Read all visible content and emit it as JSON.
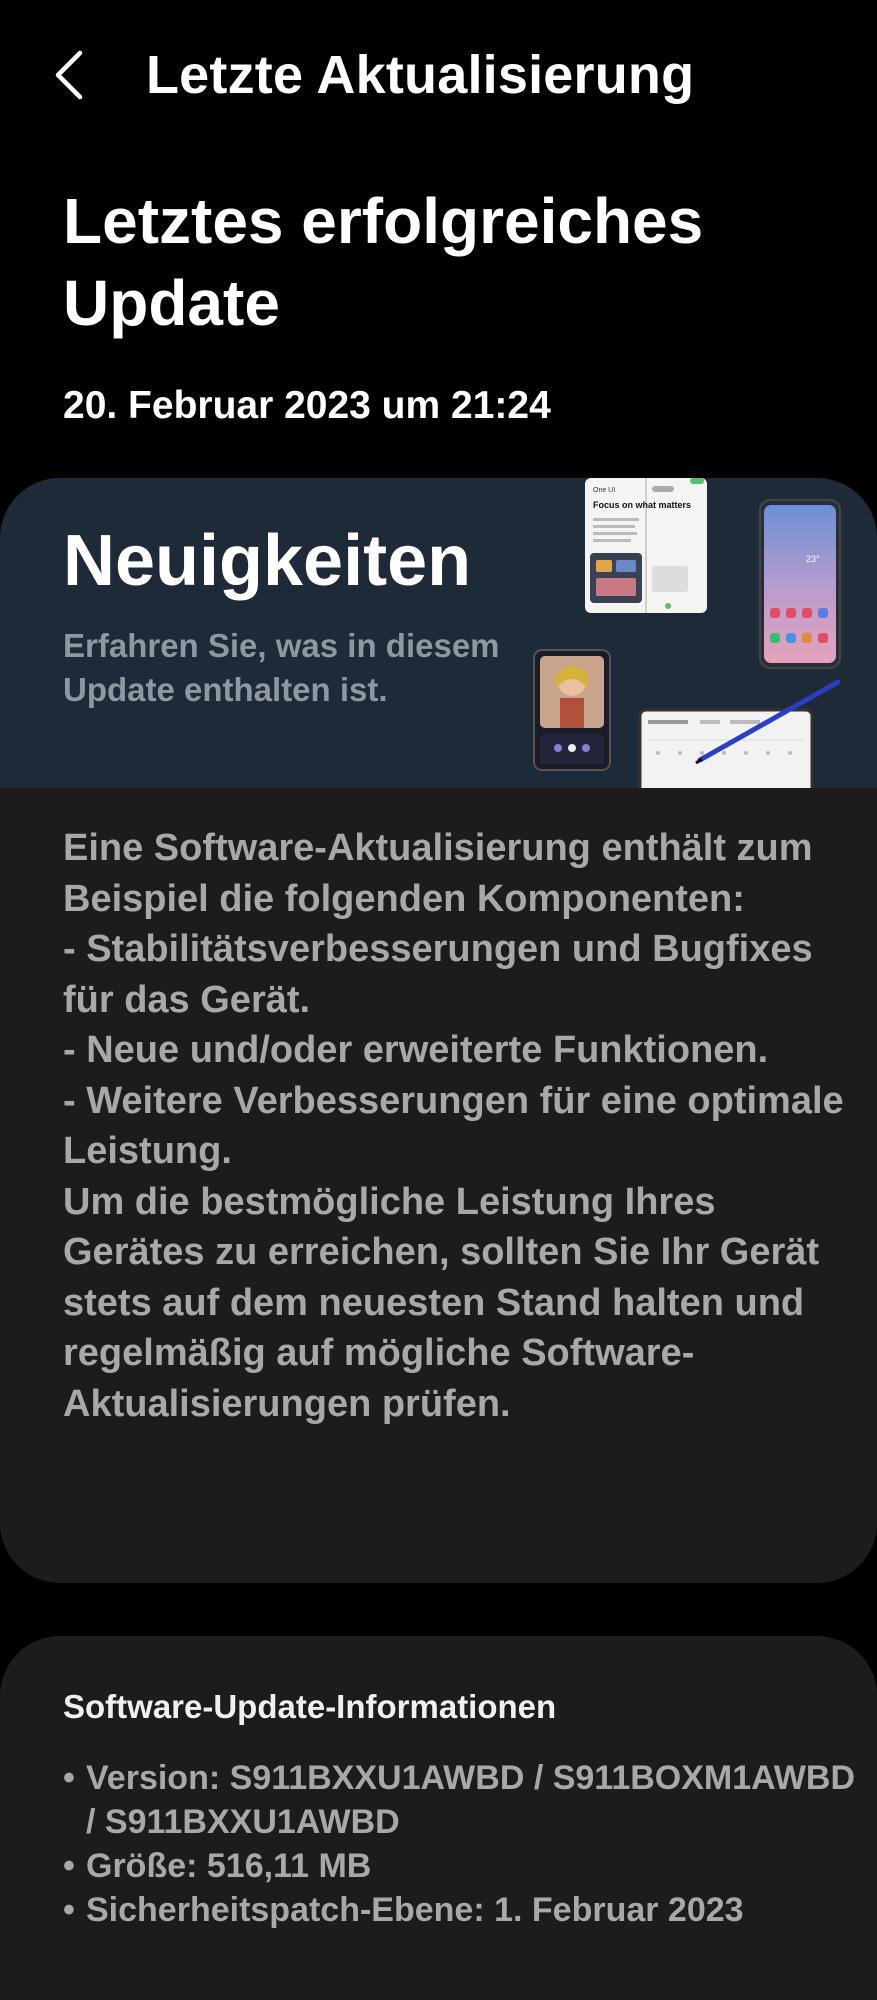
{
  "header": {
    "title": "Letzte Aktualisierung",
    "back_icon": "chevron-left-icon"
  },
  "main": {
    "title": "Letztes erfolgreiches Update",
    "date": "20. Februar 2023 um 21:24"
  },
  "news_card": {
    "title": "Neuigkeiten",
    "subtitle": "Erfahren Sie, was in diesem Update enthalten ist.",
    "description": "Eine Software-Aktualisierung enthält zum Beispiel die folgenden Komponenten:\n - Stabilitätsverbesserungen und Bugfixes für das Gerät.\n - Neue und/oder erweiterte Funktionen.\n - Weitere Verbesserungen für eine optimale Leistung.\nUm die bestmögliche Leistung Ihres Gerätes zu erreichen, sollten Sie Ihr Gerät stets auf dem neuesten Stand halten und regelmäßig auf mögliche Software-Aktualisierungen prüfen.",
    "promo_texts": {
      "brand": "One UI",
      "headline": "Focus on what matters",
      "temp": "23°"
    }
  },
  "info_card": {
    "title": "Software-Update-Informationen",
    "items": [
      {
        "bullet": "•",
        "text": "Version: S911BXXU1AWBD / S911BOXM1AWBD / S911BXXU1AWBD"
      },
      {
        "bullet": "•",
        "text": "Größe: 516,11 MB"
      },
      {
        "bullet": "•",
        "text": "Sicherheitspatch-Ebene: 1. Februar 2023"
      }
    ]
  },
  "colors": {
    "background": "#000000",
    "card": "#1c1c1c",
    "banner": "#1f2a38",
    "muted_text": "#a8a8a8"
  }
}
